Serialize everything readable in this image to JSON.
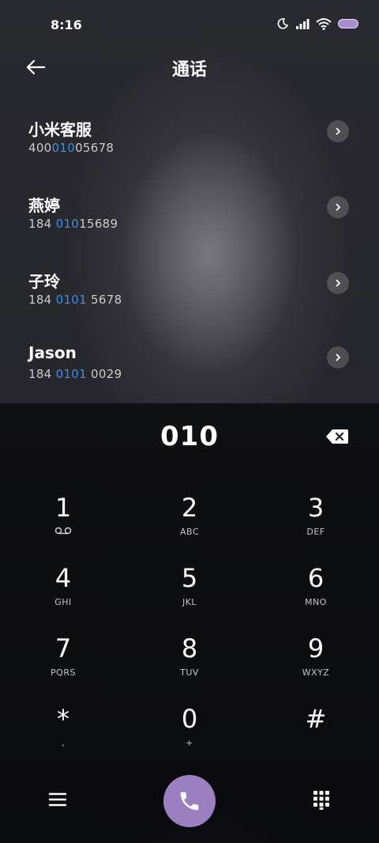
{
  "status": {
    "time": "8:16"
  },
  "header": {
    "title": "通话"
  },
  "contacts": [
    {
      "name": "小米客服",
      "pre": "400",
      "match": "010",
      "post": "05678"
    },
    {
      "name": "燕婷",
      "pre": "184 ",
      "match": "010",
      "post": "15689"
    },
    {
      "name": "子玲",
      "pre": "184 ",
      "match": "0101",
      "post": " 5678"
    },
    {
      "name": "Jason",
      "pre": "184 ",
      "match": "0101",
      "post": " 0029"
    }
  ],
  "dialer": {
    "number": "010",
    "keys": [
      {
        "digit": "1",
        "letters": ""
      },
      {
        "digit": "2",
        "letters": "ABC"
      },
      {
        "digit": "3",
        "letters": "DEF"
      },
      {
        "digit": "4",
        "letters": "GHI"
      },
      {
        "digit": "5",
        "letters": "JKL"
      },
      {
        "digit": "6",
        "letters": "MNO"
      },
      {
        "digit": "7",
        "letters": "PQRS"
      },
      {
        "digit": "8",
        "letters": "TUV"
      },
      {
        "digit": "9",
        "letters": "WXYZ"
      },
      {
        "digit": "*",
        "letters": ","
      },
      {
        "digit": "0",
        "letters": "+"
      },
      {
        "digit": "#",
        "letters": ""
      }
    ]
  },
  "colors": {
    "accent": "#3a8ee6",
    "call": "#9b7fc0",
    "battery": "#a88ed0"
  },
  "icons": {
    "back": "arrow-left-icon",
    "chevron": "chevron-right-icon",
    "backspace": "backspace-icon",
    "voicemail": "voicemail-icon",
    "menu": "menu-icon",
    "call": "phone-icon",
    "keypad": "keypad-icon"
  }
}
